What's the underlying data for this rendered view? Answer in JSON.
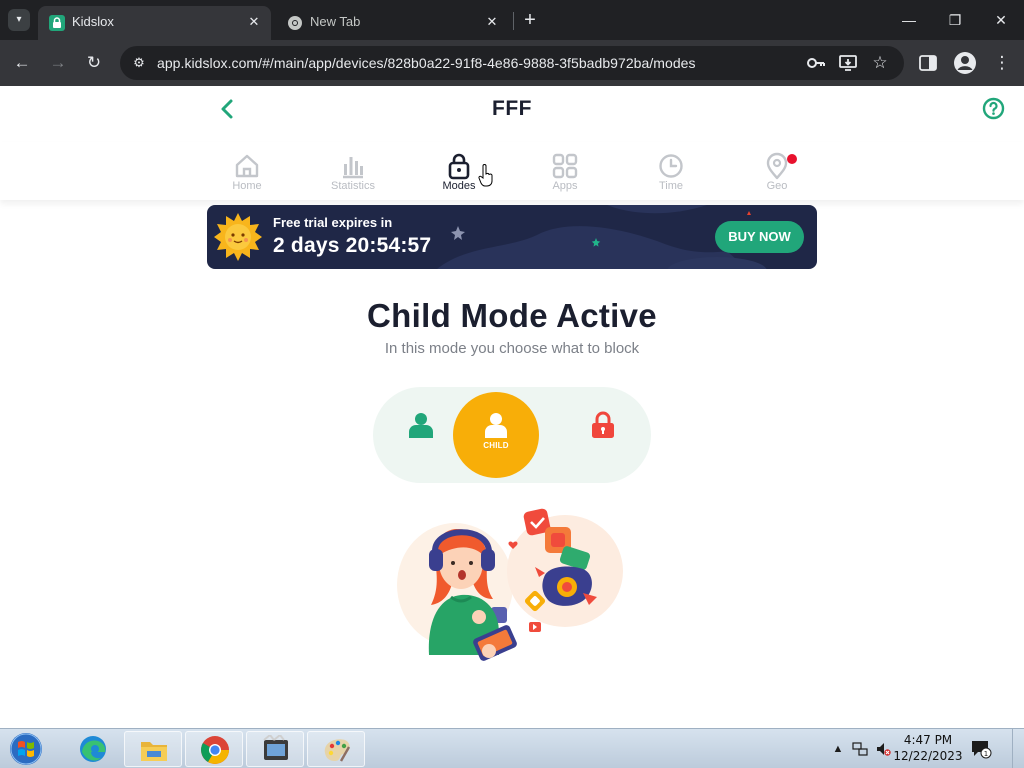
{
  "browser": {
    "tabs": [
      {
        "title": "Kidslox",
        "active": true
      },
      {
        "title": "New Tab",
        "active": false
      }
    ],
    "url": "app.kidslox.com/#/main/app/devices/828b0a22-91f8-4e86-9888-3f5badb972ba/modes"
  },
  "app": {
    "device_name": "FFF",
    "nav": [
      {
        "label": "Home",
        "icon": "home-icon"
      },
      {
        "label": "Statistics",
        "icon": "statistics-icon"
      },
      {
        "label": "Modes",
        "icon": "lock-icon",
        "active": true
      },
      {
        "label": "Apps",
        "icon": "apps-grid-icon"
      },
      {
        "label": "Time",
        "icon": "clock-icon"
      },
      {
        "label": "Geo",
        "icon": "location-pin-icon",
        "notification": true
      }
    ],
    "banner": {
      "label": "Free trial expires in",
      "countdown": "2 days 20:54:57",
      "button": "BUY NOW"
    },
    "mode": {
      "title": "Child Mode Active",
      "subtitle": "In this mode you choose what to block",
      "options": [
        {
          "label": "",
          "icon": "parent-icon",
          "color": "#21a67a"
        },
        {
          "label": "CHILD",
          "icon": "child-icon",
          "color": "#f8ae08",
          "selected": true
        },
        {
          "label": "",
          "icon": "lock-icon",
          "color": "#f0463c"
        }
      ]
    }
  },
  "taskbar": {
    "time": "4:47 PM",
    "date": "12/22/2023",
    "apps": [
      "edge-icon",
      "file-explorer-icon",
      "chrome-icon",
      "movie-maker-icon",
      "paint-icon"
    ]
  },
  "colors": {
    "accent_green": "#21a67a",
    "banner_bg": "#1f2747",
    "child_yellow": "#f8ae08",
    "lock_red": "#f0463c",
    "text_dark": "#1b1f2f"
  }
}
